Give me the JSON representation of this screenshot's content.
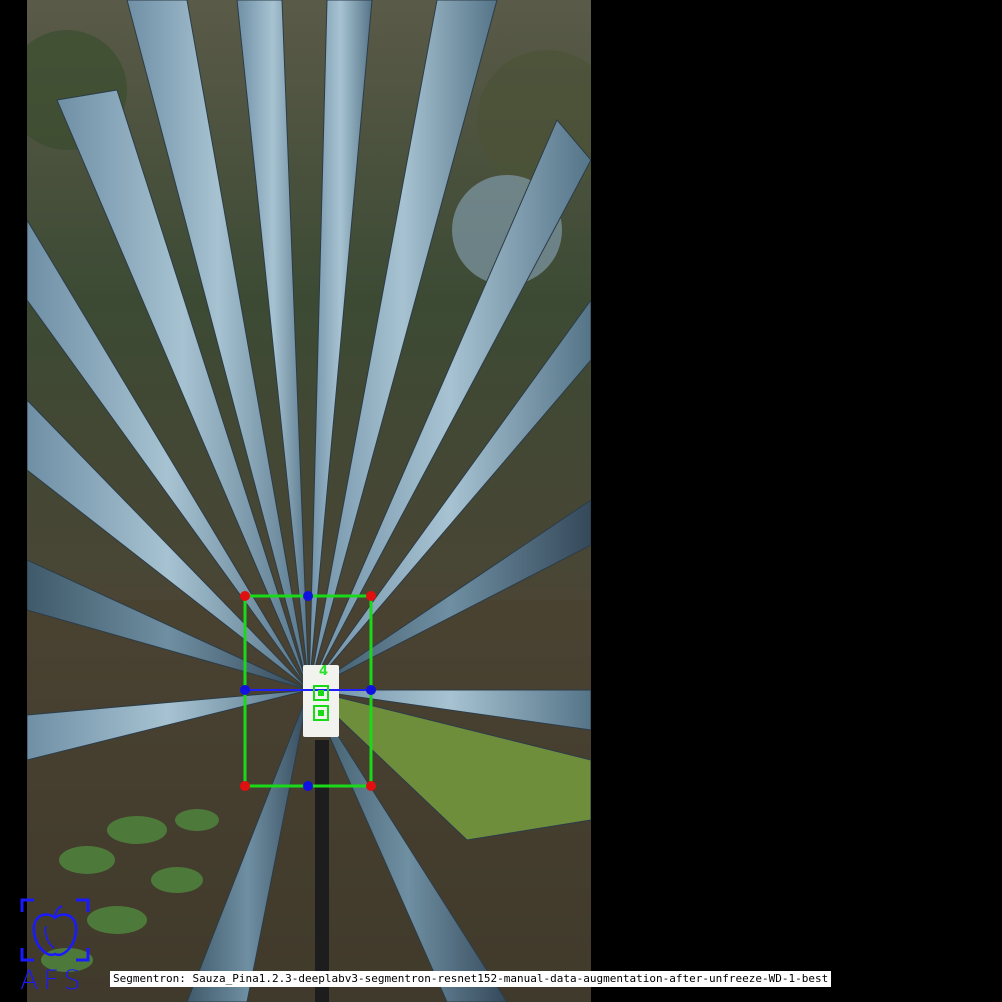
{
  "caption": {
    "text": "Segmentron: Sauza_Pina1.2.3-deeplabv3-segmentron-resnet152-manual-data-augmentation-after-unfreeze-WD-1-best"
  },
  "logo": {
    "text": "AFS",
    "icon": "apple-scan-icon",
    "color": "#1a1aff"
  },
  "marker": {
    "number": "4"
  },
  "colors": {
    "bbox": "#19d919",
    "midline": "#2020ff",
    "corner_points": "#e01010",
    "mid_points": "#1010e0"
  }
}
